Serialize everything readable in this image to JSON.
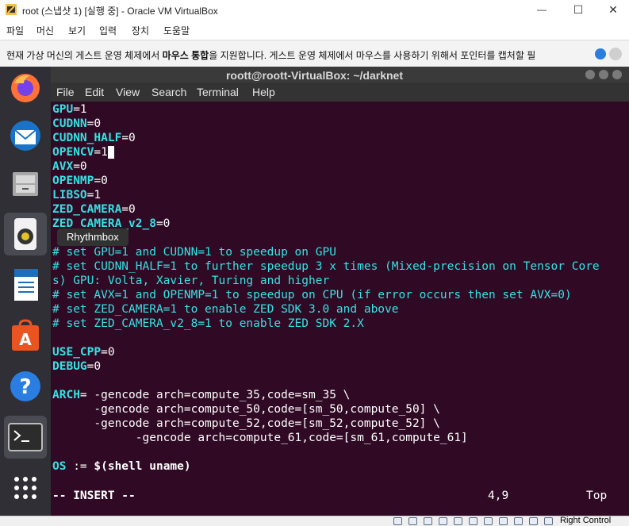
{
  "window": {
    "title": "root (스냅샷 1) [실행 중] - Oracle VM VirtualBox",
    "minimize": "—",
    "maximize": "☐",
    "close": "✕"
  },
  "vb_menu": [
    "파일",
    "머신",
    "보기",
    "입력",
    "장치",
    "도움말"
  ],
  "notification": {
    "text_pre": "현재 가상 머신의 게스트 운영 체제에서 ",
    "text_bold": "마우스 통합",
    "text_post": "을 지원합니다. 게스트 운영 체제에서 마우스를 사용하기 위해서 포인터를 캡처할 필"
  },
  "terminal": {
    "title": "roott@roott-VirtualBox: ~/darknet",
    "menu": [
      "File",
      "Edit",
      "View",
      "Search",
      "Terminal",
      "Help"
    ],
    "lines": [
      {
        "key": "GPU",
        "rest": "=1"
      },
      {
        "key": "CUDNN",
        "rest": "=0"
      },
      {
        "key": "CUDNN_HALF",
        "rest": "=0"
      },
      {
        "key": "OPENCV",
        "rest": "=1"
      },
      {
        "key": "AVX",
        "rest": "=0"
      },
      {
        "key": "OPENMP",
        "rest": "=0"
      },
      {
        "key": "LIBSO",
        "rest": "=1"
      },
      {
        "key": "ZED_CAMERA",
        "rest": "=0"
      },
      {
        "key": "ZED_CAMERA_v2_8",
        "rest": "=0"
      }
    ],
    "comments": [
      "# set GPU=1 and CUDNN=1 to speedup on GPU",
      "# set CUDNN_HALF=1 to further speedup 3 x times (Mixed-precision on Tensor Core",
      "s) GPU: Volta, Xavier, Turing and higher",
      "# set AVX=1 and OPENMP=1 to speedup on CPU (if error occurs then set AVX=0)",
      "# set ZED_CAMERA=1 to enable ZED SDK 3.0 and above",
      "# set ZED_CAMERA_v2_8=1 to enable ZED SDK 2.X"
    ],
    "lines2": [
      {
        "key": "USE_CPP",
        "rest": "=0"
      },
      {
        "key": "DEBUG",
        "rest": "=0"
      }
    ],
    "arch": {
      "key": "ARCH",
      "line1": "= -gencode arch=compute_35,code=sm_35 \\",
      "line2": "      -gencode arch=compute_50,code=[sm_50,compute_50] \\",
      "line3": "      -gencode arch=compute_52,code=[sm_52,compute_52] \\",
      "line4": "            -gencode arch=compute_61,code=[sm_61,compute_61]"
    },
    "os_line": {
      "key": "OS",
      "op": " := ",
      "val": "$(shell uname)"
    },
    "status": {
      "mode": "-- INSERT --",
      "position": "4,9",
      "scroll": "Top"
    }
  },
  "dock": {
    "items": [
      "firefox-icon",
      "thunderbird-icon",
      "files-icon",
      "rhythmbox-icon",
      "writer-icon",
      "software-icon",
      "help-icon",
      "terminal-icon",
      "apps-grid-icon"
    ],
    "tooltip": "Rhythmbox"
  },
  "vb_status": {
    "host_key": "Right Control"
  },
  "colors": {
    "terminal_bg": "#300a24",
    "keyword": "#34e2e2",
    "dock_bg": "#2f2f35"
  }
}
